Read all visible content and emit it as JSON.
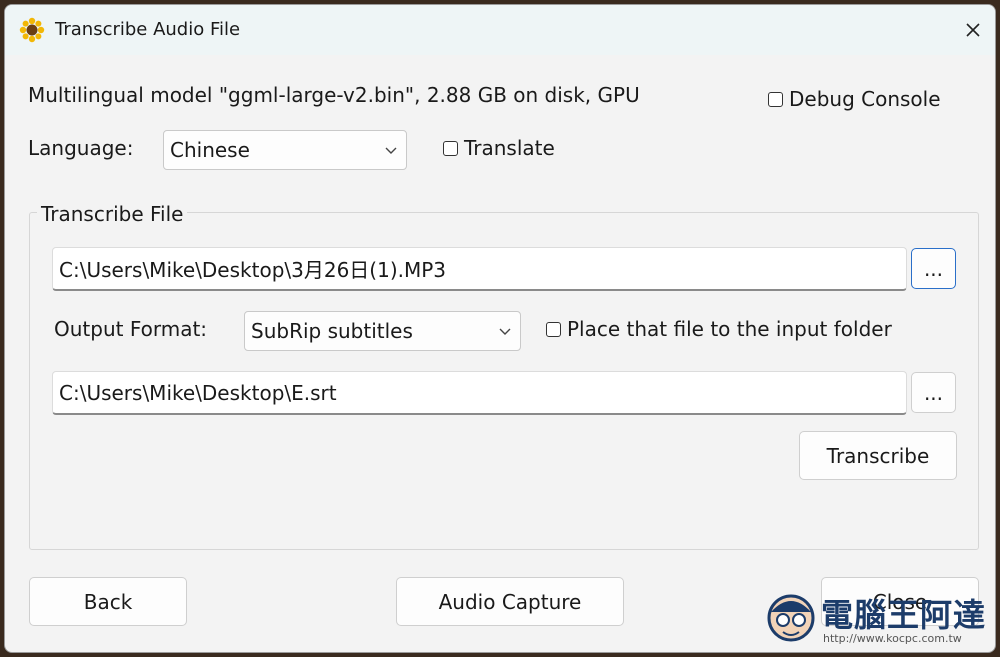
{
  "window": {
    "title": "Transcribe Audio File",
    "app_icon": "sunflower-icon",
    "close_icon": "close-icon"
  },
  "model_info": "Multilingual model \"ggml-large-v2.bin\", 2.88 GB on disk, GPU",
  "debug_console": {
    "label": "Debug Console",
    "checked": false
  },
  "language": {
    "label": "Language:",
    "selected": "Chinese"
  },
  "translate": {
    "label": "Translate",
    "checked": false
  },
  "transcribe_group": {
    "title": "Transcribe File",
    "input_path": "C:\\Users\\Mike\\Desktop\\3月26日(1).MP3",
    "browse_label": "...",
    "output_format_label": "Output Format:",
    "output_format_selected": "SubRip subtitles",
    "place_in_input_folder": {
      "label": "Place that file to the input folder",
      "checked": false
    },
    "output_path": "C:\\Users\\Mike\\Desktop\\E.srt",
    "output_browse_label": "...",
    "transcribe_label": "Transcribe"
  },
  "footer": {
    "back_label": "Back",
    "audio_capture_label": "Audio Capture",
    "close_label": "Close"
  },
  "watermark": {
    "text": "電腦王阿達",
    "url": "http://www.kocpc.com.tw"
  }
}
